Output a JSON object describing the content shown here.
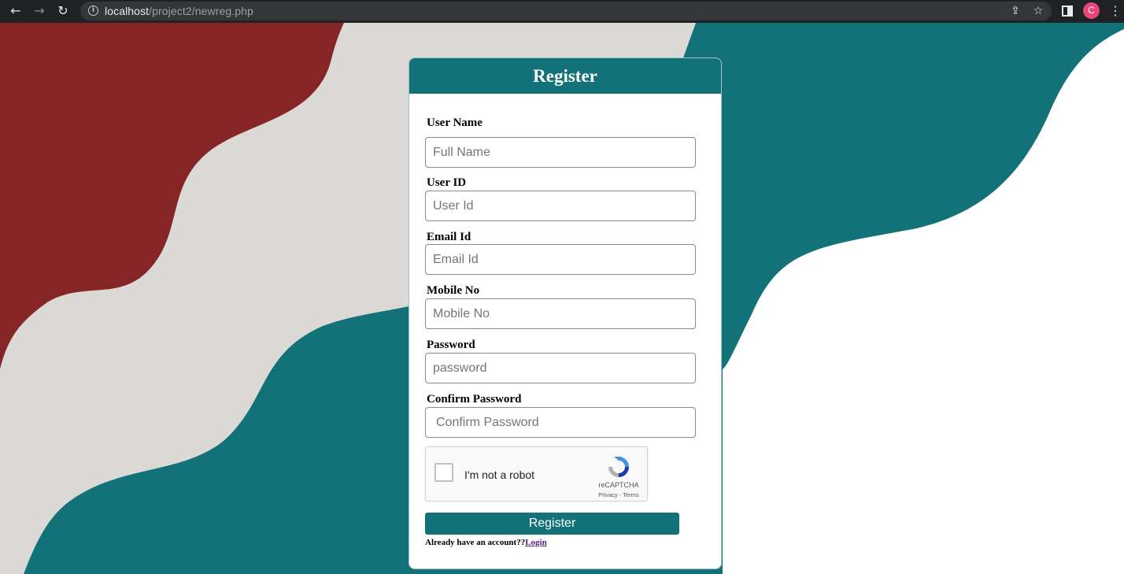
{
  "browser": {
    "url_host": "localhost",
    "url_path": "/project2/newreg.php",
    "profile_initial": "C",
    "icons": [
      "back-icon",
      "forward-icon",
      "reload-icon",
      "info-icon",
      "share-icon",
      "star-icon",
      "sidepanel-icon",
      "kebab-menu-icon"
    ]
  },
  "colors": {
    "teal": "#137278",
    "maroon": "#862526",
    "stone": "#dad9d5"
  },
  "form": {
    "title": "Register",
    "fields": [
      {
        "label": "User Name",
        "placeholder": "Full Name"
      },
      {
        "label": "User ID",
        "placeholder": "User Id"
      },
      {
        "label": "Email Id",
        "placeholder": "Email Id"
      },
      {
        "label": "Mobile No",
        "placeholder": "Mobile No"
      },
      {
        "label": "Password",
        "placeholder": "password"
      },
      {
        "label": "Confirm Password",
        "placeholder": "Confirm Password"
      }
    ],
    "captcha": {
      "label": "I'm not a robot",
      "brand": "reCAPTCHA",
      "links": "Privacy - Terms"
    },
    "submit_label": "Register",
    "account_prompt": "Already have an account??",
    "login_link": "Login"
  }
}
